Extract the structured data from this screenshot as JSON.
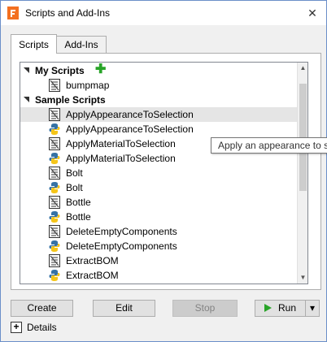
{
  "window": {
    "title": "Scripts and Add-Ins",
    "close_glyph": "✕"
  },
  "tabs": [
    {
      "label": "Scripts"
    },
    {
      "label": "Add-Ins"
    }
  ],
  "tree": {
    "groups": [
      {
        "label": "My Scripts",
        "items": [
          {
            "label": "bumpmap",
            "type": "js"
          }
        ]
      },
      {
        "label": "Sample Scripts",
        "items": [
          {
            "label": "ApplyAppearanceToSelection",
            "type": "js",
            "selected": true
          },
          {
            "label": "ApplyAppearanceToSelection",
            "type": "py"
          },
          {
            "label": "ApplyMaterialToSelection",
            "type": "js"
          },
          {
            "label": "ApplyMaterialToSelection",
            "type": "py"
          },
          {
            "label": "Bolt",
            "type": "js"
          },
          {
            "label": "Bolt",
            "type": "py"
          },
          {
            "label": "Bottle",
            "type": "js"
          },
          {
            "label": "Bottle",
            "type": "py"
          },
          {
            "label": "DeleteEmptyComponents",
            "type": "js"
          },
          {
            "label": "DeleteEmptyComponents",
            "type": "py"
          },
          {
            "label": "ExtractBOM",
            "type": "js"
          },
          {
            "label": "ExtractBOM",
            "type": "py"
          }
        ]
      }
    ],
    "add_glyph": "✚"
  },
  "tooltip": "Apply an appearance to selection",
  "buttons": {
    "create": "Create",
    "edit": "Edit",
    "stop": "Stop",
    "run": "Run",
    "dropdown_glyph": "▾"
  },
  "details": {
    "label": "Details",
    "glyph": "+"
  },
  "colors": {
    "accent_green": "#28a428",
    "window_border": "#6b8fc9",
    "selection": "#e5e5e5"
  }
}
